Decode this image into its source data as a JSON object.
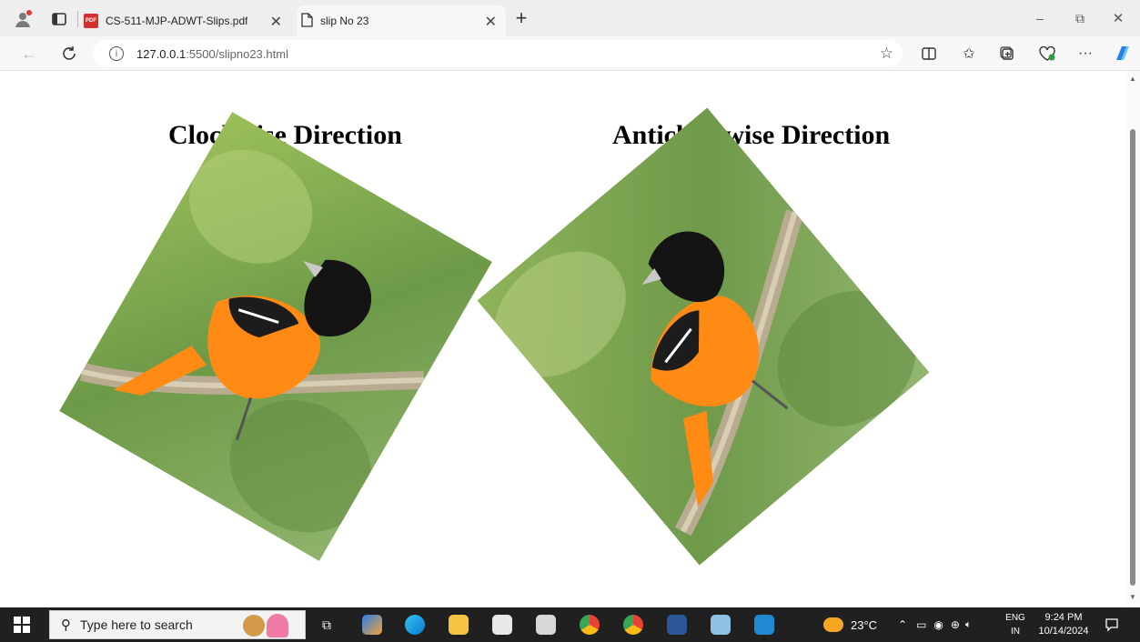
{
  "browser": {
    "tabs": [
      {
        "title": "CS-511-MJP-ADWT-Slips.pdf",
        "icon": "pdf-icon"
      },
      {
        "title": "slip No 23",
        "icon": "page-icon"
      }
    ],
    "new_tab_label": "+",
    "address": {
      "host": "127.0.0.1",
      "path": ":5500/slipno23.html"
    },
    "window": {
      "minimize": "–",
      "restore": "⧉",
      "close": "✕"
    }
  },
  "page": {
    "headings": {
      "clockwise": "Clockwise Direction",
      "anticlockwise": "Anticlockwise Direction"
    },
    "colors": {
      "oriole_orange": "#ff8a14",
      "oriole_black": "#141414",
      "leaf_green": "#7fae4b"
    }
  },
  "taskbar": {
    "search_placeholder": "Type here to search",
    "weather": "23°C",
    "lang_top": "ENG",
    "lang_bottom": "IN",
    "time": "9:24 PM",
    "date": "10/14/2024"
  }
}
